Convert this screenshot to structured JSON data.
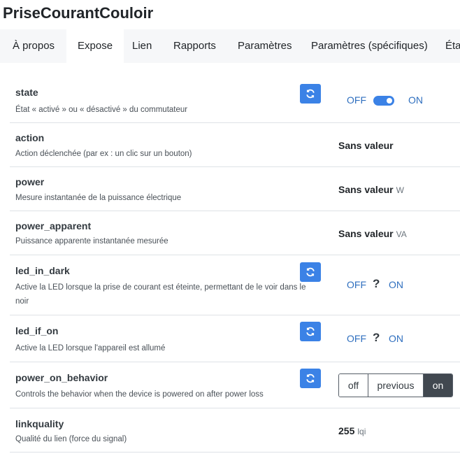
{
  "device": {
    "title": "PriseCourantCouloir"
  },
  "tabs": [
    {
      "label": "À propos"
    },
    {
      "label": "Expose",
      "active": true
    },
    {
      "label": "Lien"
    },
    {
      "label": "Rapports"
    },
    {
      "label": "Paramètres"
    },
    {
      "label": "Paramètres (spécifiques)"
    },
    {
      "label": "État"
    }
  ],
  "exposes": {
    "state": {
      "name": "state",
      "description": "État « activé » ou « désactivé » du commutateur",
      "off_label": "OFF",
      "on_label": "ON",
      "value": "ON"
    },
    "action": {
      "name": "action",
      "description": "Action déclenchée (par ex : un clic sur un bouton)",
      "value": "Sans valeur"
    },
    "power": {
      "name": "power",
      "description": "Mesure instantanée de la puissance électrique",
      "value": "Sans valeur",
      "unit": "W"
    },
    "power_apparent": {
      "name": "power_apparent",
      "description": "Puissance apparente instantanée mesurée",
      "value": "Sans valeur",
      "unit": "VA"
    },
    "led_in_dark": {
      "name": "led_in_dark",
      "description": "Active la LED lorsque la prise de courant est éteinte, permettant de le voir dans le noir",
      "off_label": "OFF",
      "unknown": "?",
      "on_label": "ON"
    },
    "led_if_on": {
      "name": "led_if_on",
      "description": "Active la LED lorsque l'appareil est allumé",
      "off_label": "OFF",
      "unknown": "?",
      "on_label": "ON"
    },
    "power_on_behavior": {
      "name": "power_on_behavior",
      "description": "Controls the behavior when the device is powered on after power loss",
      "options": [
        "off",
        "previous",
        "on"
      ],
      "selected": "on"
    },
    "linkquality": {
      "name": "linkquality",
      "description": "Qualité du lien (force du signal)",
      "value": "255",
      "unit": "lqi"
    }
  },
  "icons": {
    "refresh": "refresh-icon"
  },
  "colors": {
    "accent": "#3b82e6",
    "selected_segment": "#414850",
    "toggle_label": "#2f6fbf"
  }
}
